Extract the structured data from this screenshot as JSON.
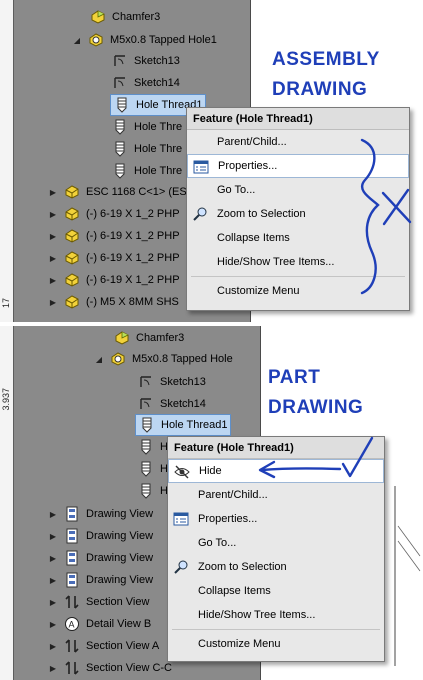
{
  "top": {
    "ruler_label": "17",
    "tree": [
      {
        "label": "Chamfer3",
        "icon": "chamfer-icon"
      },
      {
        "label": "M5x0.8 Tapped Hole1",
        "icon": "tapped-hole-icon"
      },
      {
        "label": "Sketch13",
        "icon": "sketch-icon"
      },
      {
        "label": "Sketch14",
        "icon": "sketch-icon"
      },
      {
        "label": "Hole Thread1",
        "icon": "cosmetic-thread-icon"
      },
      {
        "label": "Hole Thre",
        "icon": "cosmetic-thread-icon"
      },
      {
        "label": "Hole Thre",
        "icon": "cosmetic-thread-icon"
      },
      {
        "label": "Hole Thre",
        "icon": "cosmetic-thread-icon"
      },
      {
        "label": "ESC 1168 C<1> (ES",
        "icon": "part-icon"
      },
      {
        "label": "(-) 6-19 X 1_2 PHP",
        "icon": "part-icon"
      },
      {
        "label": "(-) 6-19 X 1_2 PHP",
        "icon": "part-icon"
      },
      {
        "label": "(-) 6-19 X 1_2 PHP",
        "icon": "part-icon"
      },
      {
        "label": "(-) 6-19 X 1_2 PHP",
        "icon": "part-icon"
      },
      {
        "label": "(-) M5 X 8MM SHS",
        "icon": "part-icon"
      }
    ],
    "menu": {
      "title": "Feature (Hole Thread1)",
      "items": [
        "Parent/Child...",
        "Properties...",
        "Go To...",
        "Zoom to Selection",
        "Collapse Items",
        "Hide/Show Tree Items...",
        "Customize Menu"
      ]
    },
    "annotation": [
      "ASSEMBLY",
      "DRAWING"
    ]
  },
  "bottom": {
    "ruler_label": "3.937",
    "tree": [
      {
        "label": "Chamfer3",
        "icon": "chamfer-icon"
      },
      {
        "label": "M5x0.8 Tapped Hole",
        "icon": "tapped-hole-icon"
      },
      {
        "label": "Sketch13",
        "icon": "sketch-icon"
      },
      {
        "label": "Sketch14",
        "icon": "sketch-icon"
      },
      {
        "label": "Hole Thread1",
        "icon": "cosmetic-thread-icon"
      },
      {
        "label": "H",
        "icon": "cosmetic-thread-icon"
      },
      {
        "label": "H",
        "icon": "cosmetic-thread-icon"
      },
      {
        "label": "H",
        "icon": "cosmetic-thread-icon"
      },
      {
        "label": "Drawing View",
        "icon": "drawing-view-icon"
      },
      {
        "label": "Drawing View",
        "icon": "drawing-view-icon"
      },
      {
        "label": "Drawing View",
        "icon": "drawing-view-icon"
      },
      {
        "label": "Drawing View",
        "icon": "drawing-view-icon"
      },
      {
        "label": "Section View",
        "icon": "section-view-icon"
      },
      {
        "label": "Detail View B",
        "icon": "detail-view-icon"
      },
      {
        "label": "Section View A",
        "icon": "section-view-icon"
      },
      {
        "label": "Section View C-C",
        "icon": "section-view-icon"
      }
    ],
    "menu": {
      "title": "Feature (Hole Thread1)",
      "items": [
        "Hide",
        "Parent/Child...",
        "Properties...",
        "Go To...",
        "Zoom to Selection",
        "Collapse Items",
        "Hide/Show Tree Items...",
        "Customize Menu"
      ]
    },
    "annotation": [
      "PART",
      "DRAWING"
    ]
  },
  "colors": {
    "tree_background": "#8a8a8a",
    "selection": "#bcd6f2",
    "menu_background": "#e8e8e8",
    "ink": "#1f3fb8"
  }
}
